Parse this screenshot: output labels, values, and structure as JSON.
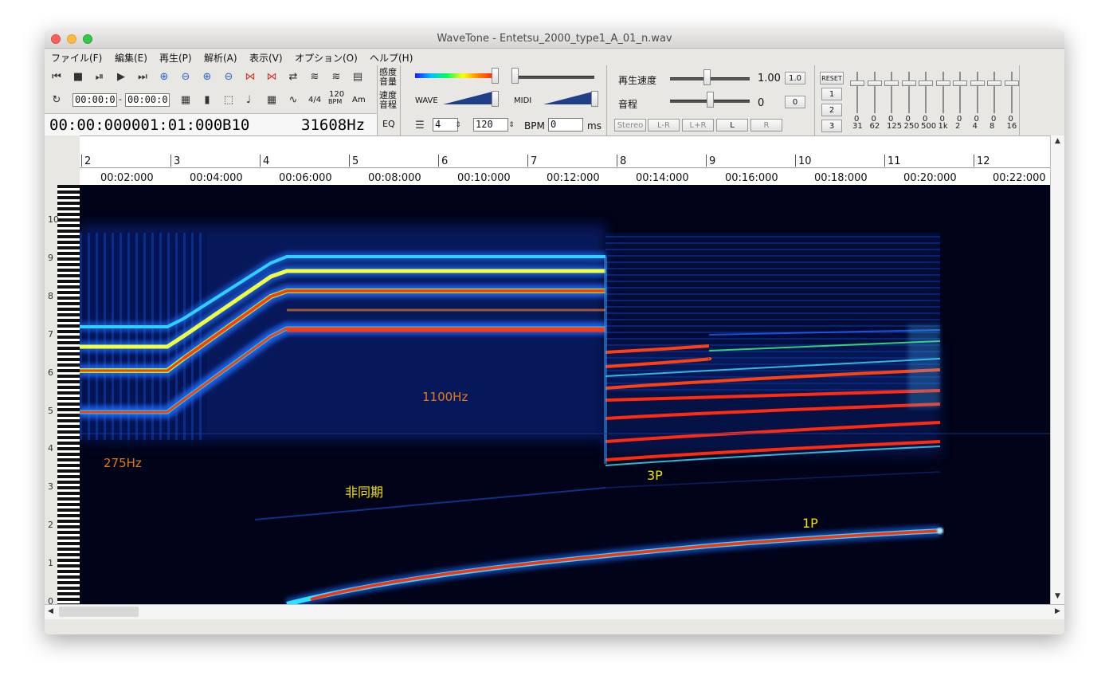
{
  "window": {
    "title": "WaveTone - Entetsu_2000_type1_A_01_n.wav"
  },
  "menu": [
    "ファイル(F)",
    "編集(E)",
    "再生(P)",
    "解析(A)",
    "表示(V)",
    "オプション(O)",
    "ヘルプ(H)"
  ],
  "toolbar": {
    "loop_start": "00:00:0",
    "loop_end": "00:00:0",
    "time_sig": "4/4",
    "bpm_icon_top": "120",
    "bpm_icon_bottom": "BPM",
    "chord": "Am",
    "position": "00:00:000001:01:000",
    "note": "B10",
    "frequency": "31608Hz",
    "sens_label_1": "感度",
    "sens_label_2": "音量",
    "speed_label_1": "速度",
    "speed_label_2": "音程",
    "eq_label": "EQ",
    "wave_label": "WAVE",
    "midi_label": "MIDI",
    "grid_value": "4",
    "bpm_value": "120",
    "bpm_label": "BPM",
    "ms_value": "0",
    "ms_label": "ms"
  },
  "playback": {
    "speed_label": "再生速度",
    "speed_value": "1.00",
    "speed_reset": "1.0",
    "pitch_label": "音程",
    "pitch_value": "0",
    "pitch_reset": "0",
    "channels": [
      "Stereo",
      "L-R",
      "L+R",
      "L",
      "R"
    ]
  },
  "equalizer": {
    "reset_label": "RESET",
    "presets": [
      "1",
      "2",
      "3"
    ],
    "gains": [
      "0",
      "0",
      "0",
      "0",
      "0",
      "0",
      "0",
      "0",
      "0",
      "0"
    ],
    "bands": [
      "31",
      "62",
      "125",
      "250",
      "500",
      "1k",
      "2",
      "4",
      "8",
      "16"
    ]
  },
  "ruler": {
    "measures": [
      "2",
      "3",
      "4",
      "5",
      "6",
      "7",
      "8",
      "9",
      "10",
      "11",
      "12"
    ],
    "times": [
      "00:02:000",
      "00:04:000",
      "00:06:000",
      "00:08:000",
      "00:10:000",
      "00:12:000",
      "00:14:000",
      "00:16:000",
      "00:18:000",
      "00:20:000",
      "00:22:000"
    ]
  },
  "piano": {
    "octaves": [
      "10",
      "9",
      "8",
      "7",
      "6",
      "5",
      "4",
      "3",
      "2",
      "1",
      "0"
    ]
  },
  "annotations": {
    "hz275": "275Hz",
    "hz1100": "1100Hz",
    "async": "非同期",
    "p3": "3P",
    "p1": "1P"
  }
}
